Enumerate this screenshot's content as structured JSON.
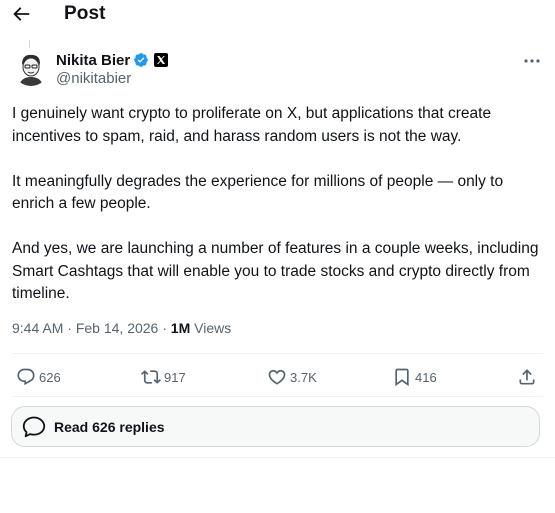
{
  "header": {
    "title": "Post"
  },
  "author": {
    "name": "Nikita Bier",
    "handle": "@nikitabier",
    "verified_color": "#1d9bf0"
  },
  "tweet": {
    "paragraphs": [
      "I genuinely want crypto to proliferate on X, but applications that create incentives to spam, raid, and harass random users is not the way.",
      "It meaningfully degrades the experience for millions of people — only to enrich a few people.",
      "And yes, we are launching a number of features in a couple weeks, including Smart Cashtags that will enable you to trade stocks and crypto directly from timeline."
    ],
    "time": "9:44 AM",
    "separator": "·",
    "date": "Feb 14, 2026",
    "views_count": "1M",
    "views_label": "Views"
  },
  "actions": {
    "replies": "626",
    "reposts": "917",
    "likes": "3.7K",
    "bookmarks": "416"
  },
  "read_replies_label": "Read 626 replies",
  "colors": {
    "text": "#0f1419",
    "secondary": "#536471",
    "border": "#cfd9de"
  }
}
